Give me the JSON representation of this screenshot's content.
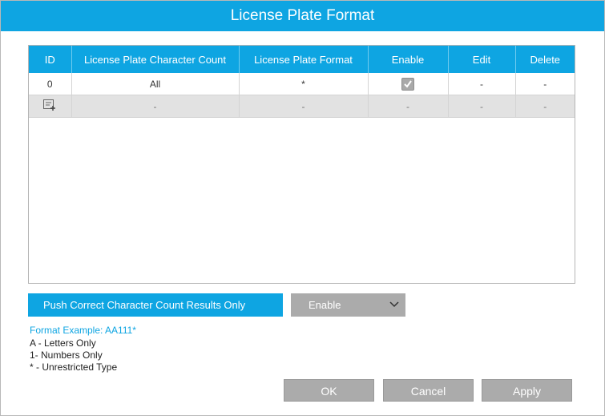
{
  "dialog": {
    "title": "License Plate Format"
  },
  "table": {
    "headers": {
      "id": "ID",
      "count": "License Plate Character Count",
      "format": "License Plate Format",
      "enable": "Enable",
      "edit": "Edit",
      "delete": "Delete"
    },
    "rows": [
      {
        "id": "0",
        "count": "All",
        "format": "*",
        "enable_checked": true,
        "edit": "-",
        "delete": "-"
      }
    ],
    "add_row": {
      "count": "-",
      "format": "-",
      "enable": "-",
      "edit": "-",
      "delete": "-",
      "icon": "add-row-icon"
    }
  },
  "push_setting": {
    "label": "Push Correct Character Count Results Only",
    "value": "Enable"
  },
  "format_help": {
    "example": "Format Example: AA111*",
    "lines": [
      "A - Letters Only",
      "1- Numbers Only",
      "* - Unrestricted Type"
    ]
  },
  "buttons": {
    "ok": "OK",
    "cancel": "Cancel",
    "apply": "Apply"
  },
  "colors": {
    "accent": "#0ea5e2",
    "button_gray": "#ababab",
    "row_gray": "#e2e2e2"
  }
}
